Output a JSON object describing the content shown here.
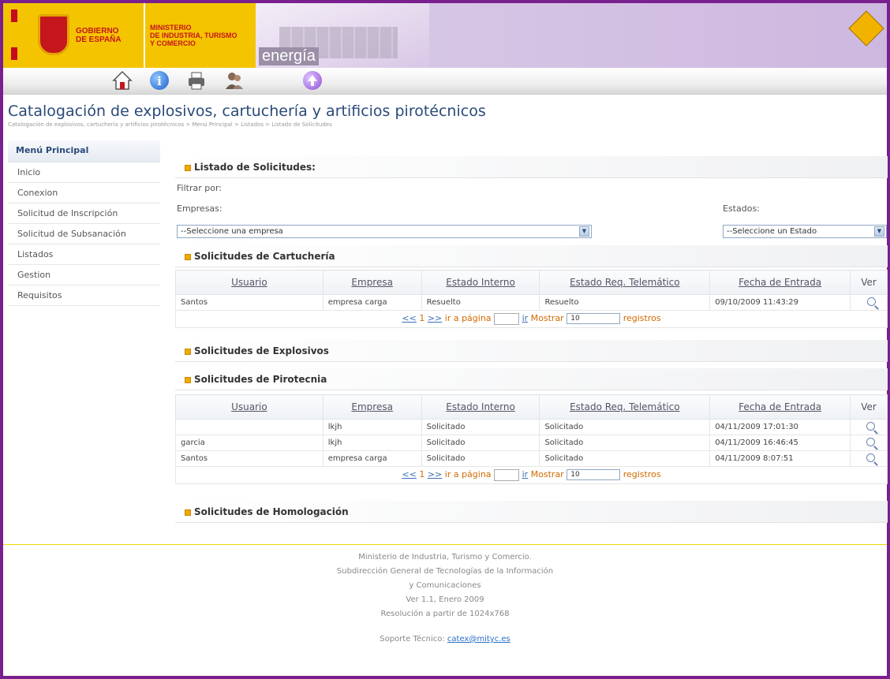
{
  "header": {
    "gobierno": "GOBIERNO\nDE ESPAÑA",
    "gobierno_l1": "GOBIERNO",
    "gobierno_l2": "DE ESPAÑA",
    "ministerio_l1": "MINISTERIO",
    "ministerio_l2": "DE INDUSTRIA, TURISMO",
    "ministerio_l3": "Y COMERCIO",
    "energia": "energía"
  },
  "toolbar": {
    "icons": [
      "home-icon",
      "info-icon",
      "print-icon",
      "people-icon",
      "up-icon"
    ]
  },
  "page": {
    "title": "Catalogación de explosivos, cartuchería y artificios pirotécnicos",
    "breadcrumb": "Catalogación de explosivos, cartuchería y artificios pirotécnicos > Menú Principal > Listados > Listado de Solicitudes"
  },
  "sidebar": {
    "title": "Menú Principal",
    "items": [
      "Inicio",
      "Conexion",
      "Solicitud de Inscripción",
      "Solicitud de Subsanación",
      "Listados",
      "Gestion",
      "Requisitos"
    ]
  },
  "main": {
    "heading": "Listado de Solicitudes:",
    "filter_label": "Filtrar por:",
    "empresas_label": "Empresas:",
    "empresas_value": "--Seleccione una empresa",
    "estados_label": "Estados:",
    "estados_value": "--Seleccione un Estado",
    "columns": [
      "Usuario",
      "Empresa",
      "Estado Interno",
      "Estado Req. Telemático",
      "Fecha de Entrada",
      "Ver"
    ],
    "cartucheria": {
      "title": "Solicitudes de Cartuchería",
      "rows": [
        [
          "Santos",
          "empresa carga",
          "Resuelto",
          "Resuelto",
          "09/10/2009 11:43:29"
        ]
      ]
    },
    "explosivos": {
      "title": "Solicitudes de Explosivos"
    },
    "pirotecnia": {
      "title": "Solicitudes de Pirotecnia",
      "rows": [
        [
          "",
          "lkjh",
          "Solicitado",
          "Solicitado",
          "04/11/2009 17:01:30"
        ],
        [
          "garcia",
          "lkjh",
          "Solicitado",
          "Solicitado",
          "04/11/2009 16:46:45"
        ],
        [
          "Santos",
          "empresa carga",
          "Solicitado",
          "Solicitado",
          "04/11/2009 8:07:51"
        ]
      ]
    },
    "homologacion": {
      "title": "Solicitudes de Homologación"
    },
    "pager": {
      "first": "<<",
      "page": "1",
      "next": ">>",
      "goto": "ir a página",
      "ir": "ir",
      "mostrar": "Mostrar",
      "count": "10",
      "registros": "registros"
    }
  },
  "footer": {
    "l1": "Ministerio de Industria, Turismo y Comercio.",
    "l2": "Subdirección General de Tecnologías de la Información",
    "l3": "y Comunicaciones",
    "l4": "Ver 1.1, Enero 2009",
    "l5": "Resolución a partir de 1024x768",
    "soporte": "Soporte Técnico:",
    "email": "catex@mityc.es"
  }
}
